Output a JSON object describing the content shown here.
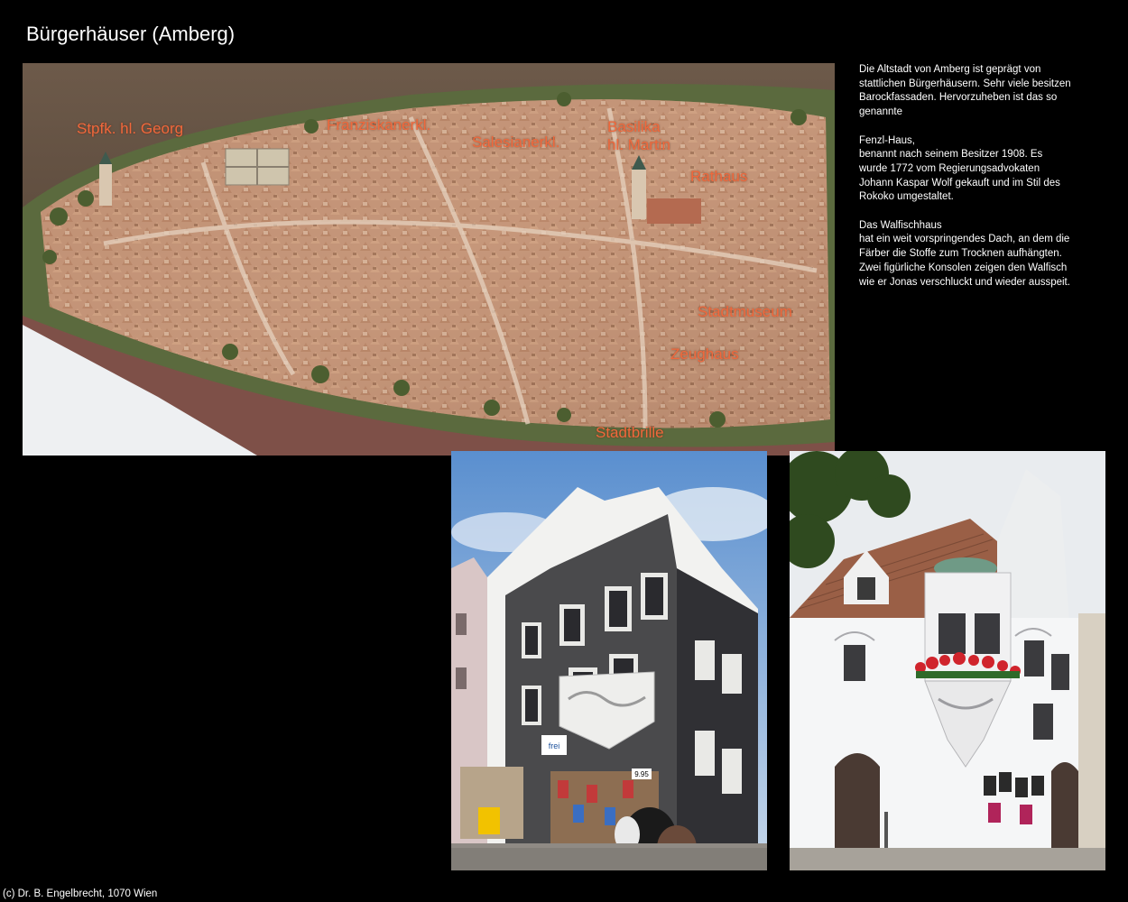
{
  "title": "Bürgerhäuser (Amberg)",
  "model_photo": {
    "labels": {
      "georg": "Stpfk. hl. Georg",
      "franziskaner": "Franziskanerkl.",
      "salesianer": "Salesianerkl.",
      "basilika_line1": "Basilika",
      "basilika_line2": "hl. Martin",
      "rathaus": "Rathaus",
      "stadtmuseum": "Stadtmuseum",
      "zeughaus": "Zeughaus",
      "stadtbrille": "Stadtbrille"
    },
    "label_color": "#f0683c"
  },
  "description": {
    "p1": "Die Altstadt von Amberg ist geprägt von stattlichen Bürgerhäusern. Sehr viele besitzen Barockfassaden. Hervorzuheben ist das so genannte",
    "p2": "Fenzl-Haus,\nbenannt nach seinem Besitzer 1908. Es wurde 1772 vom Regierungsadvokaten Johann Kaspar Wolf gekauft und im Stil des Rokoko umgestaltet.",
    "p3": "Das Walfischhaus\nhat ein weit vorspringendes Dach, an dem die Färber die Stoffe zum Trocknen aufhängten. Zwei figürliche Konsolen zeigen den Walfisch wie er Jonas verschluckt und wieder ausspeit."
  },
  "shop_signs": {
    "price": "9.95",
    "brand": "frei"
  },
  "credit": "(c) Dr. B. Engelbrecht, 1070 Wien"
}
